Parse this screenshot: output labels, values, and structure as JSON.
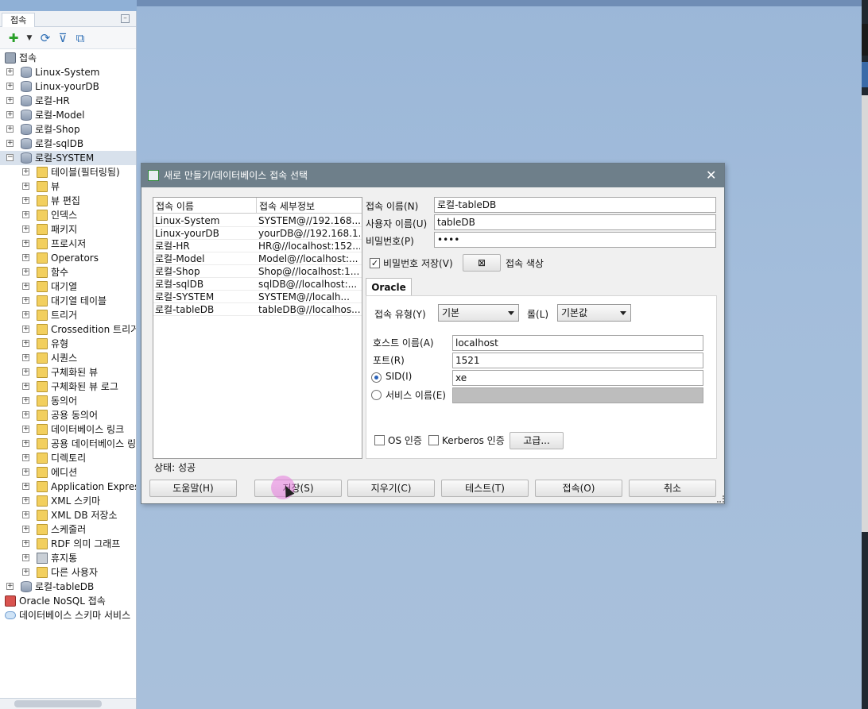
{
  "left_panel": {
    "tab_label": "접속",
    "root_label": "접속",
    "connections": [
      {
        "label": "Linux-System"
      },
      {
        "label": "Linux-yourDB"
      },
      {
        "label": "로컬-HR"
      },
      {
        "label": "로컬-Model"
      },
      {
        "label": "로컬-Shop"
      },
      {
        "label": "로컬-sqlDB"
      },
      {
        "label": "로컬-SYSTEM"
      }
    ],
    "system_children": [
      {
        "label": "테이블(필터링됨)"
      },
      {
        "label": "뷰"
      },
      {
        "label": "뷰 편집"
      },
      {
        "label": "인덱스"
      },
      {
        "label": "패키지"
      },
      {
        "label": "프로시저"
      },
      {
        "label": "Operators"
      },
      {
        "label": "함수"
      },
      {
        "label": "대기열"
      },
      {
        "label": "대기열 테이블"
      },
      {
        "label": "트리거"
      },
      {
        "label": "Crossedition 트리거"
      },
      {
        "label": "유형"
      },
      {
        "label": "시퀀스"
      },
      {
        "label": "구체화된 뷰"
      },
      {
        "label": "구체화된 뷰 로그"
      },
      {
        "label": "동의어"
      },
      {
        "label": "공용 동의어"
      },
      {
        "label": "데이터베이스 링크"
      },
      {
        "label": "공용 데이터베이스 링크"
      },
      {
        "label": "디렉토리"
      },
      {
        "label": "에디션"
      },
      {
        "label": "Application Express"
      },
      {
        "label": "XML 스키마"
      },
      {
        "label": "XML DB 저장소"
      },
      {
        "label": "스케줄러"
      },
      {
        "label": "RDF 의미 그래프"
      },
      {
        "label": "휴지통"
      },
      {
        "label": "다른 사용자"
      }
    ],
    "after": [
      {
        "label": "로컬-tableDB"
      },
      {
        "label": "Oracle NoSQL 접속"
      },
      {
        "label": "데이터베이스 스키마 서비스"
      }
    ]
  },
  "dialog": {
    "title": "새로 만들기/데이터베이스 접속 선택",
    "list_headers": [
      "접속 이름",
      "접속 세부정보"
    ],
    "list_rows": [
      {
        "name": "Linux-System",
        "detail": "SYSTEM@//192.168...."
      },
      {
        "name": "Linux-yourDB",
        "detail": "yourDB@//192.168.1...."
      },
      {
        "name": "로컬-HR",
        "detail": "HR@//localhost:152..."
      },
      {
        "name": "로컬-Model",
        "detail": "Model@//localhost:..."
      },
      {
        "name": "로컬-Shop",
        "detail": "Shop@//localhost:1..."
      },
      {
        "name": "로컬-sqlDB",
        "detail": "sqlDB@//localhost:..."
      },
      {
        "name": "로컬-SYSTEM",
        "detail": "SYSTEM@//localh..."
      },
      {
        "name": "로컬-tableDB",
        "detail": "tableDB@//localhos..."
      }
    ],
    "status": "상태: 성공",
    "conn_name_label": "접속 이름(N)",
    "conn_name_value": "로컬-tableDB",
    "user_label": "사용자 이름(U)",
    "user_value": "tableDB",
    "password_label": "비밀번호(P)",
    "password_value": "••••",
    "save_password_label": "비밀번호 저장(V)",
    "conn_color_label": "접속 색상",
    "oracle_tab": "Oracle",
    "conn_type_label": "접속 유형(Y)",
    "conn_type_value": "기본",
    "role_label": "롤(L)",
    "role_value": "기본값",
    "host_label": "호스트 이름(A)",
    "host_value": "localhost",
    "port_label": "포트(R)",
    "port_value": "1521",
    "sid_label": "SID(I)",
    "sid_value": "xe",
    "service_label": "서비스 이름(E)",
    "os_auth_label": "OS 인증",
    "kerberos_label": "Kerberos 인증",
    "advanced_label": "고급...",
    "buttons": {
      "help": "도움말(H)",
      "save": "저장(S)",
      "clear": "지우기(C)",
      "test": "테스트(T)",
      "connect": "접속(O)",
      "cancel": "취소"
    }
  }
}
